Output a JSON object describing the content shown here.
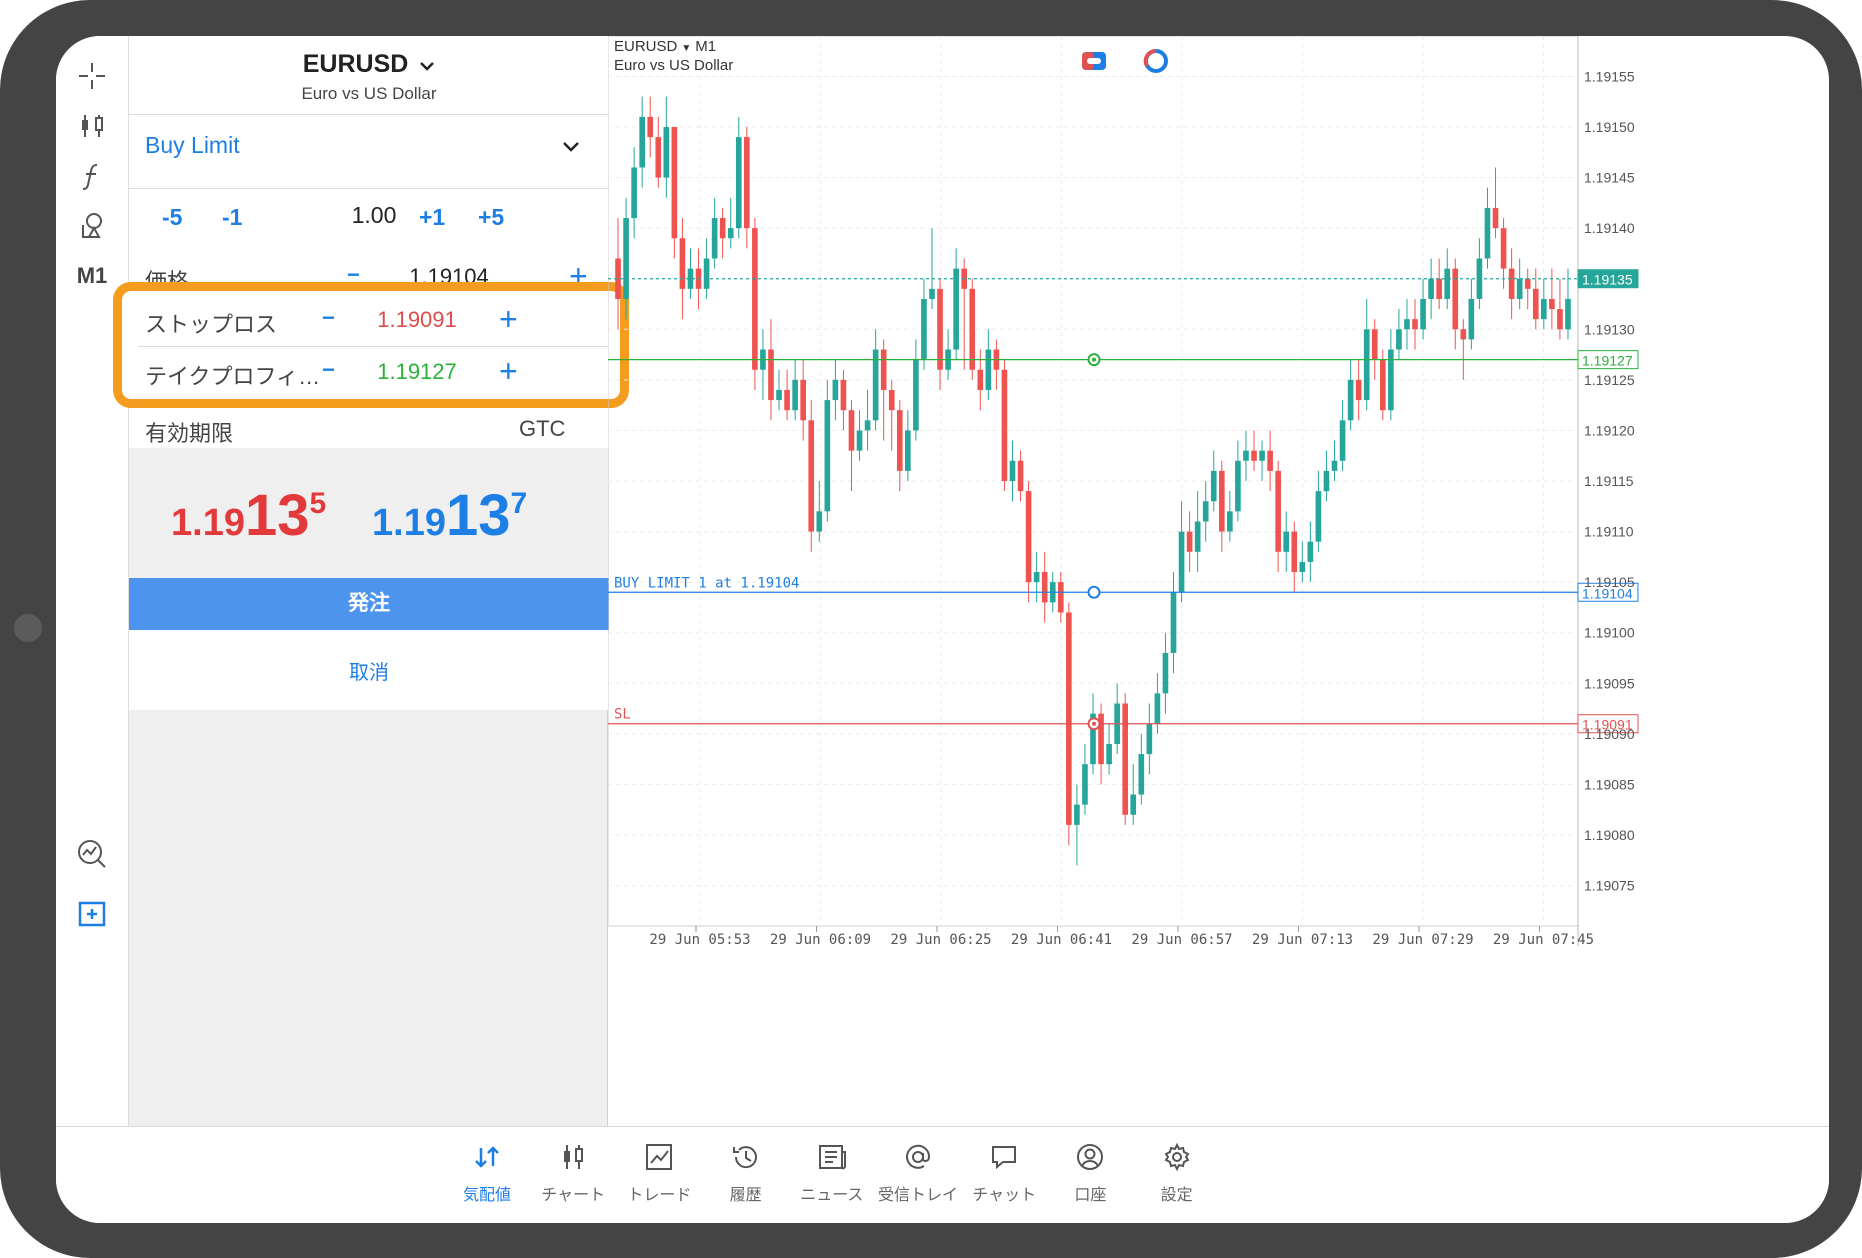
{
  "symbol": {
    "name": "EURUSD",
    "description": "Euro vs US Dollar"
  },
  "order": {
    "type": "Buy Limit",
    "steps": [
      "-5",
      "-1",
      "+1",
      "+5"
    ],
    "volume": "1.00",
    "price_label": "価格",
    "price_value": "1.19104",
    "sl_label": "ストップロス",
    "sl_value": "1.19091",
    "tp_label": "テイクプロフィ…",
    "tp_value": "1.19127",
    "expiry_label": "有効期限",
    "expiry_value": "GTC",
    "minus": "−",
    "plus": "+",
    "bid": {
      "prefix": "1.19",
      "big": "13",
      "sup": "5"
    },
    "ask": {
      "prefix": "1.19",
      "big": "13",
      "sup": "7"
    },
    "submit_label": "発注",
    "cancel_label": "取消"
  },
  "toolbar": {
    "timeframe": "M1"
  },
  "chart": {
    "symbol": "EURUSD",
    "timeframe": "M1",
    "description": "Euro vs US Dollar",
    "price_labels": [
      "1.19155",
      "1.19150",
      "1.19145",
      "1.19140",
      "1.19130",
      "1.19125",
      "1.19120",
      "1.19115",
      "1.19110",
      "1.19105",
      "1.19100",
      "1.19095",
      "1.19090",
      "1.19085",
      "1.19080",
      "1.19075"
    ],
    "time_labels": [
      "29 Jun 05:53",
      "29 Jun 06:09",
      "29 Jun 06:25",
      "29 Jun 06:41",
      "29 Jun 06:57",
      "29 Jun 07:13",
      "29 Jun 07:29",
      "29 Jun 07:45"
    ],
    "current_price": "1.19135",
    "tp_tag": "1.19127",
    "buy_limit_tag": "1.19104",
    "sl_tag": "1.19091",
    "buy_limit_label": "BUY LIMIT 1 at 1.19104",
    "sl_label": "SL",
    "colors": {
      "bull": "#26a69a",
      "bear": "#ef5350",
      "buy_limit": "#1d7fe6",
      "tp": "#2bb03a",
      "sl": "#e05252"
    }
  },
  "chart_data": {
    "type": "candlestick",
    "ylim": [
      1.19071,
      1.19159
    ],
    "levels": {
      "current": 1.19135,
      "take_profit": 1.19127,
      "buy_limit": 1.19104,
      "stop_loss": 1.19091
    },
    "candles": [
      [
        1.19137,
        1.19133,
        1.19141,
        1.1913
      ],
      [
        1.19133,
        1.19141,
        1.19143,
        1.19131
      ],
      [
        1.19141,
        1.19146,
        1.19148,
        1.19139
      ],
      [
        1.19146,
        1.19151,
        1.19153,
        1.19144
      ],
      [
        1.19151,
        1.19149,
        1.19153,
        1.19147
      ],
      [
        1.19149,
        1.19145,
        1.19151,
        1.19144
      ],
      [
        1.19145,
        1.1915,
        1.19153,
        1.19143
      ],
      [
        1.1915,
        1.19139,
        1.1915,
        1.19137
      ],
      [
        1.19139,
        1.19134,
        1.19141,
        1.19131
      ],
      [
        1.19134,
        1.19136,
        1.19138,
        1.19133
      ],
      [
        1.19136,
        1.19134,
        1.19138,
        1.19132
      ],
      [
        1.19134,
        1.19137,
        1.19139,
        1.19133
      ],
      [
        1.19137,
        1.19141,
        1.19143,
        1.19136
      ],
      [
        1.19141,
        1.19139,
        1.19142,
        1.19137
      ],
      [
        1.19139,
        1.1914,
        1.19143,
        1.19138
      ],
      [
        1.1914,
        1.19149,
        1.19151,
        1.19139
      ],
      [
        1.19149,
        1.1914,
        1.1915,
        1.19138
      ],
      [
        1.1914,
        1.19126,
        1.19141,
        1.19124
      ],
      [
        1.19126,
        1.19128,
        1.1913,
        1.19123
      ],
      [
        1.19128,
        1.19123,
        1.19131,
        1.19121
      ],
      [
        1.19123,
        1.19124,
        1.19126,
        1.19122
      ],
      [
        1.19124,
        1.19122,
        1.19126,
        1.19121
      ],
      [
        1.19122,
        1.19125,
        1.19127,
        1.19121
      ],
      [
        1.19125,
        1.19121,
        1.19127,
        1.19119
      ],
      [
        1.19121,
        1.1911,
        1.19123,
        1.19108
      ],
      [
        1.1911,
        1.19112,
        1.19115,
        1.19109
      ],
      [
        1.19112,
        1.19123,
        1.19125,
        1.19111
      ],
      [
        1.19123,
        1.19125,
        1.19127,
        1.19121
      ],
      [
        1.19125,
        1.19122,
        1.19126,
        1.1912
      ],
      [
        1.19122,
        1.19118,
        1.19123,
        1.19114
      ],
      [
        1.19118,
        1.1912,
        1.19122,
        1.19117
      ],
      [
        1.1912,
        1.19121,
        1.19124,
        1.19118
      ],
      [
        1.19121,
        1.19128,
        1.1913,
        1.1912
      ],
      [
        1.19128,
        1.19124,
        1.19129,
        1.19119
      ],
      [
        1.19124,
        1.19122,
        1.19125,
        1.19118
      ],
      [
        1.19122,
        1.19116,
        1.19123,
        1.19114
      ],
      [
        1.19116,
        1.1912,
        1.19122,
        1.19115
      ],
      [
        1.1912,
        1.19127,
        1.19129,
        1.19119
      ],
      [
        1.19127,
        1.19133,
        1.19135,
        1.19126
      ],
      [
        1.19133,
        1.19134,
        1.1914,
        1.19132
      ],
      [
        1.19134,
        1.19126,
        1.19135,
        1.19124
      ],
      [
        1.19126,
        1.19128,
        1.1913,
        1.19125
      ],
      [
        1.19128,
        1.19136,
        1.19138,
        1.19127
      ],
      [
        1.19136,
        1.19134,
        1.19137,
        1.19126
      ],
      [
        1.19134,
        1.19126,
        1.19135,
        1.19125
      ],
      [
        1.19126,
        1.19124,
        1.19128,
        1.19122
      ],
      [
        1.19124,
        1.19128,
        1.1913,
        1.19123
      ],
      [
        1.19128,
        1.19126,
        1.19129,
        1.19124
      ],
      [
        1.19126,
        1.19115,
        1.19127,
        1.19114
      ],
      [
        1.19115,
        1.19117,
        1.19119,
        1.19113
      ],
      [
        1.19117,
        1.19114,
        1.19118,
        1.19113
      ],
      [
        1.19114,
        1.19105,
        1.19115,
        1.19103
      ],
      [
        1.19105,
        1.19106,
        1.19108,
        1.19103
      ],
      [
        1.19106,
        1.19103,
        1.19108,
        1.19101
      ],
      [
        1.19103,
        1.19105,
        1.19106,
        1.19102
      ],
      [
        1.19105,
        1.19102,
        1.19106,
        1.19101
      ],
      [
        1.19102,
        1.19081,
        1.19103,
        1.19079
      ],
      [
        1.19081,
        1.19083,
        1.19085,
        1.19077
      ],
      [
        1.19083,
        1.19087,
        1.19089,
        1.19082
      ],
      [
        1.19087,
        1.19092,
        1.19094,
        1.19086
      ],
      [
        1.19092,
        1.19087,
        1.19093,
        1.19085
      ],
      [
        1.19087,
        1.19089,
        1.19091,
        1.19086
      ],
      [
        1.19089,
        1.19093,
        1.19095,
        1.19088
      ],
      [
        1.19093,
        1.19082,
        1.19094,
        1.19081
      ],
      [
        1.19082,
        1.19084,
        1.19087,
        1.19081
      ],
      [
        1.19084,
        1.19088,
        1.1909,
        1.19083
      ],
      [
        1.19088,
        1.19091,
        1.19093,
        1.19086
      ],
      [
        1.19091,
        1.19094,
        1.19096,
        1.1909
      ],
      [
        1.19094,
        1.19098,
        1.191,
        1.19092
      ],
      [
        1.19098,
        1.19104,
        1.19106,
        1.19096
      ],
      [
        1.19104,
        1.1911,
        1.19113,
        1.19103
      ],
      [
        1.1911,
        1.19108,
        1.19112,
        1.19106
      ],
      [
        1.19108,
        1.19111,
        1.19114,
        1.19106
      ],
      [
        1.19111,
        1.19113,
        1.19115,
        1.19109
      ],
      [
        1.19113,
        1.19116,
        1.19118,
        1.19112
      ],
      [
        1.19116,
        1.1911,
        1.19117,
        1.19108
      ],
      [
        1.1911,
        1.19112,
        1.19114,
        1.19109
      ],
      [
        1.19112,
        1.19117,
        1.19119,
        1.19111
      ],
      [
        1.19117,
        1.19118,
        1.1912,
        1.19115
      ],
      [
        1.19118,
        1.19117,
        1.1912,
        1.19116
      ],
      [
        1.19117,
        1.19118,
        1.19119,
        1.19115
      ],
      [
        1.19118,
        1.19116,
        1.1912,
        1.19114
      ],
      [
        1.19116,
        1.19108,
        1.19117,
        1.19106
      ],
      [
        1.19108,
        1.1911,
        1.19112,
        1.19106
      ],
      [
        1.1911,
        1.19106,
        1.19111,
        1.19104
      ],
      [
        1.19106,
        1.19107,
        1.19109,
        1.19105
      ],
      [
        1.19107,
        1.19109,
        1.19111,
        1.19105
      ],
      [
        1.19109,
        1.19114,
        1.19116,
        1.19108
      ],
      [
        1.19114,
        1.19116,
        1.19118,
        1.19113
      ],
      [
        1.19116,
        1.19117,
        1.19119,
        1.19115
      ],
      [
        1.19117,
        1.19121,
        1.19123,
        1.19116
      ],
      [
        1.19121,
        1.19125,
        1.19127,
        1.1912
      ],
      [
        1.19125,
        1.19123,
        1.19127,
        1.19121
      ],
      [
        1.19123,
        1.1913,
        1.19133,
        1.19122
      ],
      [
        1.1913,
        1.19127,
        1.19131,
        1.19125
      ],
      [
        1.19127,
        1.19122,
        1.19128,
        1.19121
      ],
      [
        1.19122,
        1.19128,
        1.1913,
        1.19121
      ],
      [
        1.19128,
        1.1913,
        1.19132,
        1.19127
      ],
      [
        1.1913,
        1.19131,
        1.19133,
        1.19128
      ],
      [
        1.19131,
        1.1913,
        1.19133,
        1.19128
      ],
      [
        1.1913,
        1.19133,
        1.19135,
        1.19129
      ],
      [
        1.19133,
        1.19135,
        1.19137,
        1.19131
      ],
      [
        1.19135,
        1.19133,
        1.19137,
        1.19132
      ],
      [
        1.19133,
        1.19136,
        1.19138,
        1.19132
      ],
      [
        1.19136,
        1.1913,
        1.19137,
        1.19128
      ],
      [
        1.1913,
        1.19129,
        1.19131,
        1.19125
      ],
      [
        1.19129,
        1.19133,
        1.19135,
        1.19128
      ],
      [
        1.19133,
        1.19137,
        1.19139,
        1.19132
      ],
      [
        1.19137,
        1.19142,
        1.19144,
        1.19136
      ],
      [
        1.19142,
        1.1914,
        1.19146,
        1.19139
      ],
      [
        1.1914,
        1.19136,
        1.19141,
        1.19134
      ],
      [
        1.19136,
        1.19133,
        1.19138,
        1.19131
      ],
      [
        1.19133,
        1.19135,
        1.19137,
        1.19132
      ],
      [
        1.19135,
        1.19134,
        1.19136,
        1.19132
      ],
      [
        1.19134,
        1.19131,
        1.19136,
        1.1913
      ],
      [
        1.19131,
        1.19133,
        1.19135,
        1.1913
      ],
      [
        1.19133,
        1.19132,
        1.19136,
        1.1913
      ],
      [
        1.19132,
        1.1913,
        1.19135,
        1.19129
      ],
      [
        1.1913,
        1.19133,
        1.19136,
        1.19129
      ]
    ]
  },
  "bottom_nav": [
    {
      "label": "気配値",
      "icon": "quotes-icon",
      "active": true
    },
    {
      "label": "チャート",
      "icon": "chart-candles-icon",
      "active": false
    },
    {
      "label": "トレード",
      "icon": "trade-icon",
      "active": false
    },
    {
      "label": "履歴",
      "icon": "history-icon",
      "active": false
    },
    {
      "label": "ニュース",
      "icon": "news-icon",
      "active": false
    },
    {
      "label": "受信トレイ",
      "icon": "mail-icon",
      "active": false
    },
    {
      "label": "チャット",
      "icon": "chat-icon",
      "active": false
    },
    {
      "label": "口座",
      "icon": "account-icon",
      "active": false
    },
    {
      "label": "設定",
      "icon": "settings-icon",
      "active": false
    }
  ]
}
